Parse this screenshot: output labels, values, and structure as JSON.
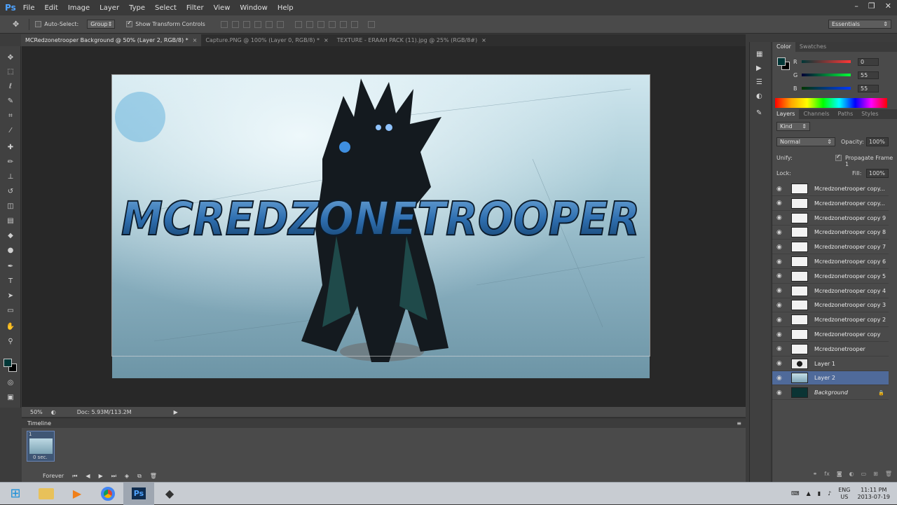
{
  "app": {
    "logo": "Ps",
    "menu": [
      "File",
      "Edit",
      "Image",
      "Layer",
      "Type",
      "Select",
      "Filter",
      "View",
      "Window",
      "Help"
    ],
    "window_controls": [
      "–",
      "❐",
      "✕"
    ]
  },
  "options_bar": {
    "auto_select_label": "Auto-Select:",
    "auto_select_value": "Group",
    "show_transform_label": "Show Transform Controls",
    "workspace": "Essentials"
  },
  "document_tabs": [
    {
      "label": "MCRedzonetrooper Background @ 50% (Layer 2, RGB/8) *",
      "active": true
    },
    {
      "label": "Capture.PNG @ 100% (Layer 0, RGB/8) *",
      "active": false
    },
    {
      "label": "TEXTURE - ERAAH PACK (11).jpg @ 25% (RGB/8#)",
      "active": false
    }
  ],
  "canvas": {
    "title_text": "MCREDZONETROOPER",
    "accent": "#2f6fb0"
  },
  "status_bar": {
    "zoom": "50%",
    "doc": "Doc: 5.93M/113.2M"
  },
  "timeline": {
    "title": "Timeline",
    "frame_number": "1",
    "frame_delay": "0 sec.",
    "loop": "Forever"
  },
  "color_panel": {
    "tabs": [
      "Color",
      "Swatches"
    ],
    "r": "0",
    "g": "55",
    "b": "55",
    "r_label": "R",
    "g_label": "G",
    "b_label": "B",
    "foreground": "#003737"
  },
  "layers_panel": {
    "tabs": [
      "Layers",
      "Channels",
      "Paths",
      "Styles"
    ],
    "kind_label": "Kind",
    "blend_mode": "Normal",
    "opacity_label": "Opacity:",
    "opacity": "100%",
    "unify_label": "Unify:",
    "propagate_label": "Propagate Frame 1",
    "lock_label": "Lock:",
    "fill_label": "Fill:",
    "fill": "100%",
    "layers": [
      {
        "name": "Mcredzonetrooper copy...",
        "thumb": "text"
      },
      {
        "name": "Mcredzonetrooper copy...",
        "thumb": "text"
      },
      {
        "name": "Mcredzonetrooper copy 9",
        "thumb": "text"
      },
      {
        "name": "Mcredzonetrooper copy 8",
        "thumb": "text"
      },
      {
        "name": "Mcredzonetrooper copy 7",
        "thumb": "text"
      },
      {
        "name": "Mcredzonetrooper copy 6",
        "thumb": "text"
      },
      {
        "name": "Mcredzonetrooper copy 5",
        "thumb": "text"
      },
      {
        "name": "Mcredzonetrooper copy 4",
        "thumb": "text"
      },
      {
        "name": "Mcredzonetrooper copy 3",
        "thumb": "text"
      },
      {
        "name": "Mcredzonetrooper copy 2",
        "thumb": "text"
      },
      {
        "name": "Mcredzonetrooper copy",
        "thumb": "text"
      },
      {
        "name": "Mcredzonetrooper",
        "thumb": "text"
      },
      {
        "name": "Layer 1",
        "thumb": "figure"
      },
      {
        "name": "Layer 2",
        "thumb": "texture",
        "selected": true
      },
      {
        "name": "Background",
        "thumb": "dark",
        "locked": true
      }
    ]
  },
  "taskbar": {
    "lang": "ENG",
    "region": "US",
    "time": "11:11 PM",
    "date": "2013-07-19"
  }
}
